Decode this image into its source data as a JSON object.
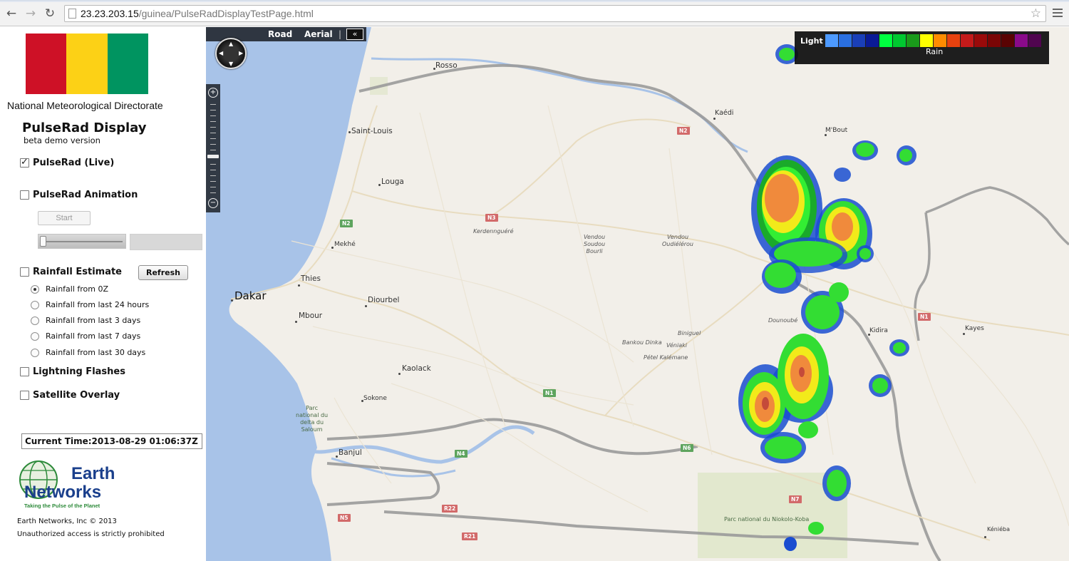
{
  "browser": {
    "url_host": "23.23.203.15",
    "url_path": "/guinea/PulseRadDisplayTestPage.html"
  },
  "sidebar": {
    "flag_colors": [
      "#ce1126",
      "#fcd116",
      "#009460"
    ],
    "org_name": "National Meteorological Directorate",
    "title": "PulseRad Display",
    "subtitle": "beta demo version",
    "pulserad_live": "PulseRad (Live)",
    "pulserad_animation": "PulseRad Animation",
    "start_label": "Start",
    "rainfall_estimate": "Rainfall Estimate",
    "refresh_label": "Refresh",
    "rainfall_options": [
      "Rainfall from 0Z",
      "Rainfall from last 24 hours",
      "Rainfall from last 3 days",
      "Rainfall from last 7 days",
      "Rainfall from last 30 days"
    ],
    "lightning": "Lightning Flashes",
    "satellite": "Satellite Overlay",
    "current_time": "Current Time:2013-08-29 01:06:37Z",
    "logo_line1": "Earth",
    "logo_line2": "Networks",
    "logo_tagline": "Taking the Pulse of the Planet",
    "copyright": "Earth Networks, Inc © 2013",
    "unauthorized": "Unauthorized access is strictly prohibited"
  },
  "map": {
    "nav": {
      "road": "Road",
      "aerial": "Aerial",
      "collapse": "«"
    },
    "legend": {
      "light": "Light",
      "rain": "Rain",
      "colors": [
        "#4d9aff",
        "#2a6fe0",
        "#1a3fb8",
        "#0a1a96",
        "#00ff40",
        "#00c830",
        "#1a9a1a",
        "#ffff00",
        "#ff8c00",
        "#e8420f",
        "#c41a1a",
        "#9a0a0a",
        "#7a0505",
        "#5a0303",
        "#8a0a8a",
        "#50054f"
      ]
    },
    "cities": {
      "dakar": "Dakar",
      "rosso": "Rosso",
      "saint_louis": "Saint-Louis",
      "louga": "Louga",
      "mekhe": "Mekhé",
      "thies": "Thies",
      "mbour": "Mbour",
      "diourbel": "Diourbel",
      "kaolack": "Kaolack",
      "sokone": "Sokone",
      "banjul": "Banjul",
      "kaedi": "Kaédi",
      "mbout": "M'Bout",
      "kidira": "Kidira",
      "kayes": "Kayes",
      "kenieba": "Kéniéba",
      "dounoube": "Dounoubé"
    },
    "places": {
      "kerdennguere": "Kerdennguéré",
      "vendou_soudou": [
        "Vendou",
        "Soudou",
        "Bourli"
      ],
      "vendou_oudie": [
        "Vendou",
        "Oudiélérou"
      ],
      "bankou_dinka": "Bankou Dinka",
      "biniguel": "Biniguel",
      "veniaki": "Véniaki",
      "petel": "Pétel Kalémane"
    },
    "parks": {
      "saloum": [
        "Parc",
        "national du",
        "delta du",
        "Saloum"
      ],
      "niokolo": "Parc national du Niokolo-Koba"
    },
    "roads": {
      "n2_top": "N2",
      "n2_left": "N2",
      "n3": "N3",
      "n1_mid": "N1",
      "n1_right": "N1",
      "n4": "N4",
      "n6": "N6",
      "n7": "N7",
      "n5": "N5",
      "r22": "R22",
      "r21": "R21"
    }
  }
}
